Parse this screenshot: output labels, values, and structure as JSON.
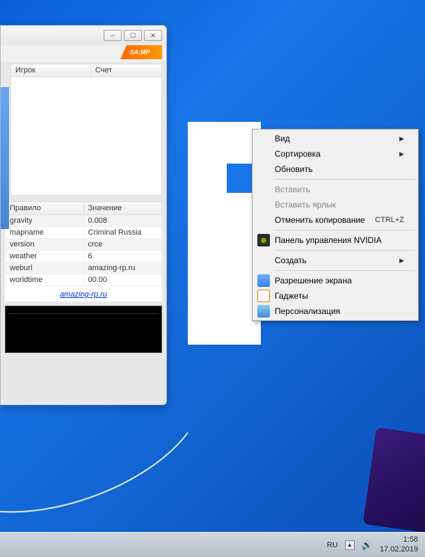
{
  "samp": {
    "logo_text": "SA:MP",
    "players_headers": {
      "player": "Игрок",
      "score": "Счет"
    },
    "rules_headers": {
      "rule": "Правило",
      "value": "Значение"
    },
    "rules": [
      {
        "name": "gravity",
        "value": "0.008"
      },
      {
        "name": "mapname",
        "value": "Criminal Russia"
      },
      {
        "name": "version",
        "value": "crce"
      },
      {
        "name": "weather",
        "value": "6"
      },
      {
        "name": "weburl",
        "value": "amazing-rp.ru"
      },
      {
        "name": "worldtime",
        "value": "00:00"
      }
    ],
    "link": "amazing-rp.ru"
  },
  "context_menu": {
    "items": [
      {
        "label": "Вид",
        "arrow": true
      },
      {
        "label": "Сортировка",
        "arrow": true
      },
      {
        "label": "Обновить"
      },
      {
        "sep": true
      },
      {
        "label": "Вставить",
        "disabled": true
      },
      {
        "label": "Вставить ярлык",
        "disabled": true
      },
      {
        "label": "Отменить копирование",
        "shortcut": "CTRL+Z"
      },
      {
        "sep": true
      },
      {
        "label": "Панель управления NVIDIA",
        "icon": "nvidia"
      },
      {
        "sep": true
      },
      {
        "label": "Создать",
        "arrow": true
      },
      {
        "sep": true
      },
      {
        "label": "Разрешение экрана",
        "icon": "resolution"
      },
      {
        "label": "Гаджеты",
        "icon": "gadgets"
      },
      {
        "label": "Персонализация",
        "icon": "personalize"
      }
    ]
  },
  "taskbar": {
    "lang": "RU",
    "time": "1:58",
    "date": "17.02.2019"
  }
}
